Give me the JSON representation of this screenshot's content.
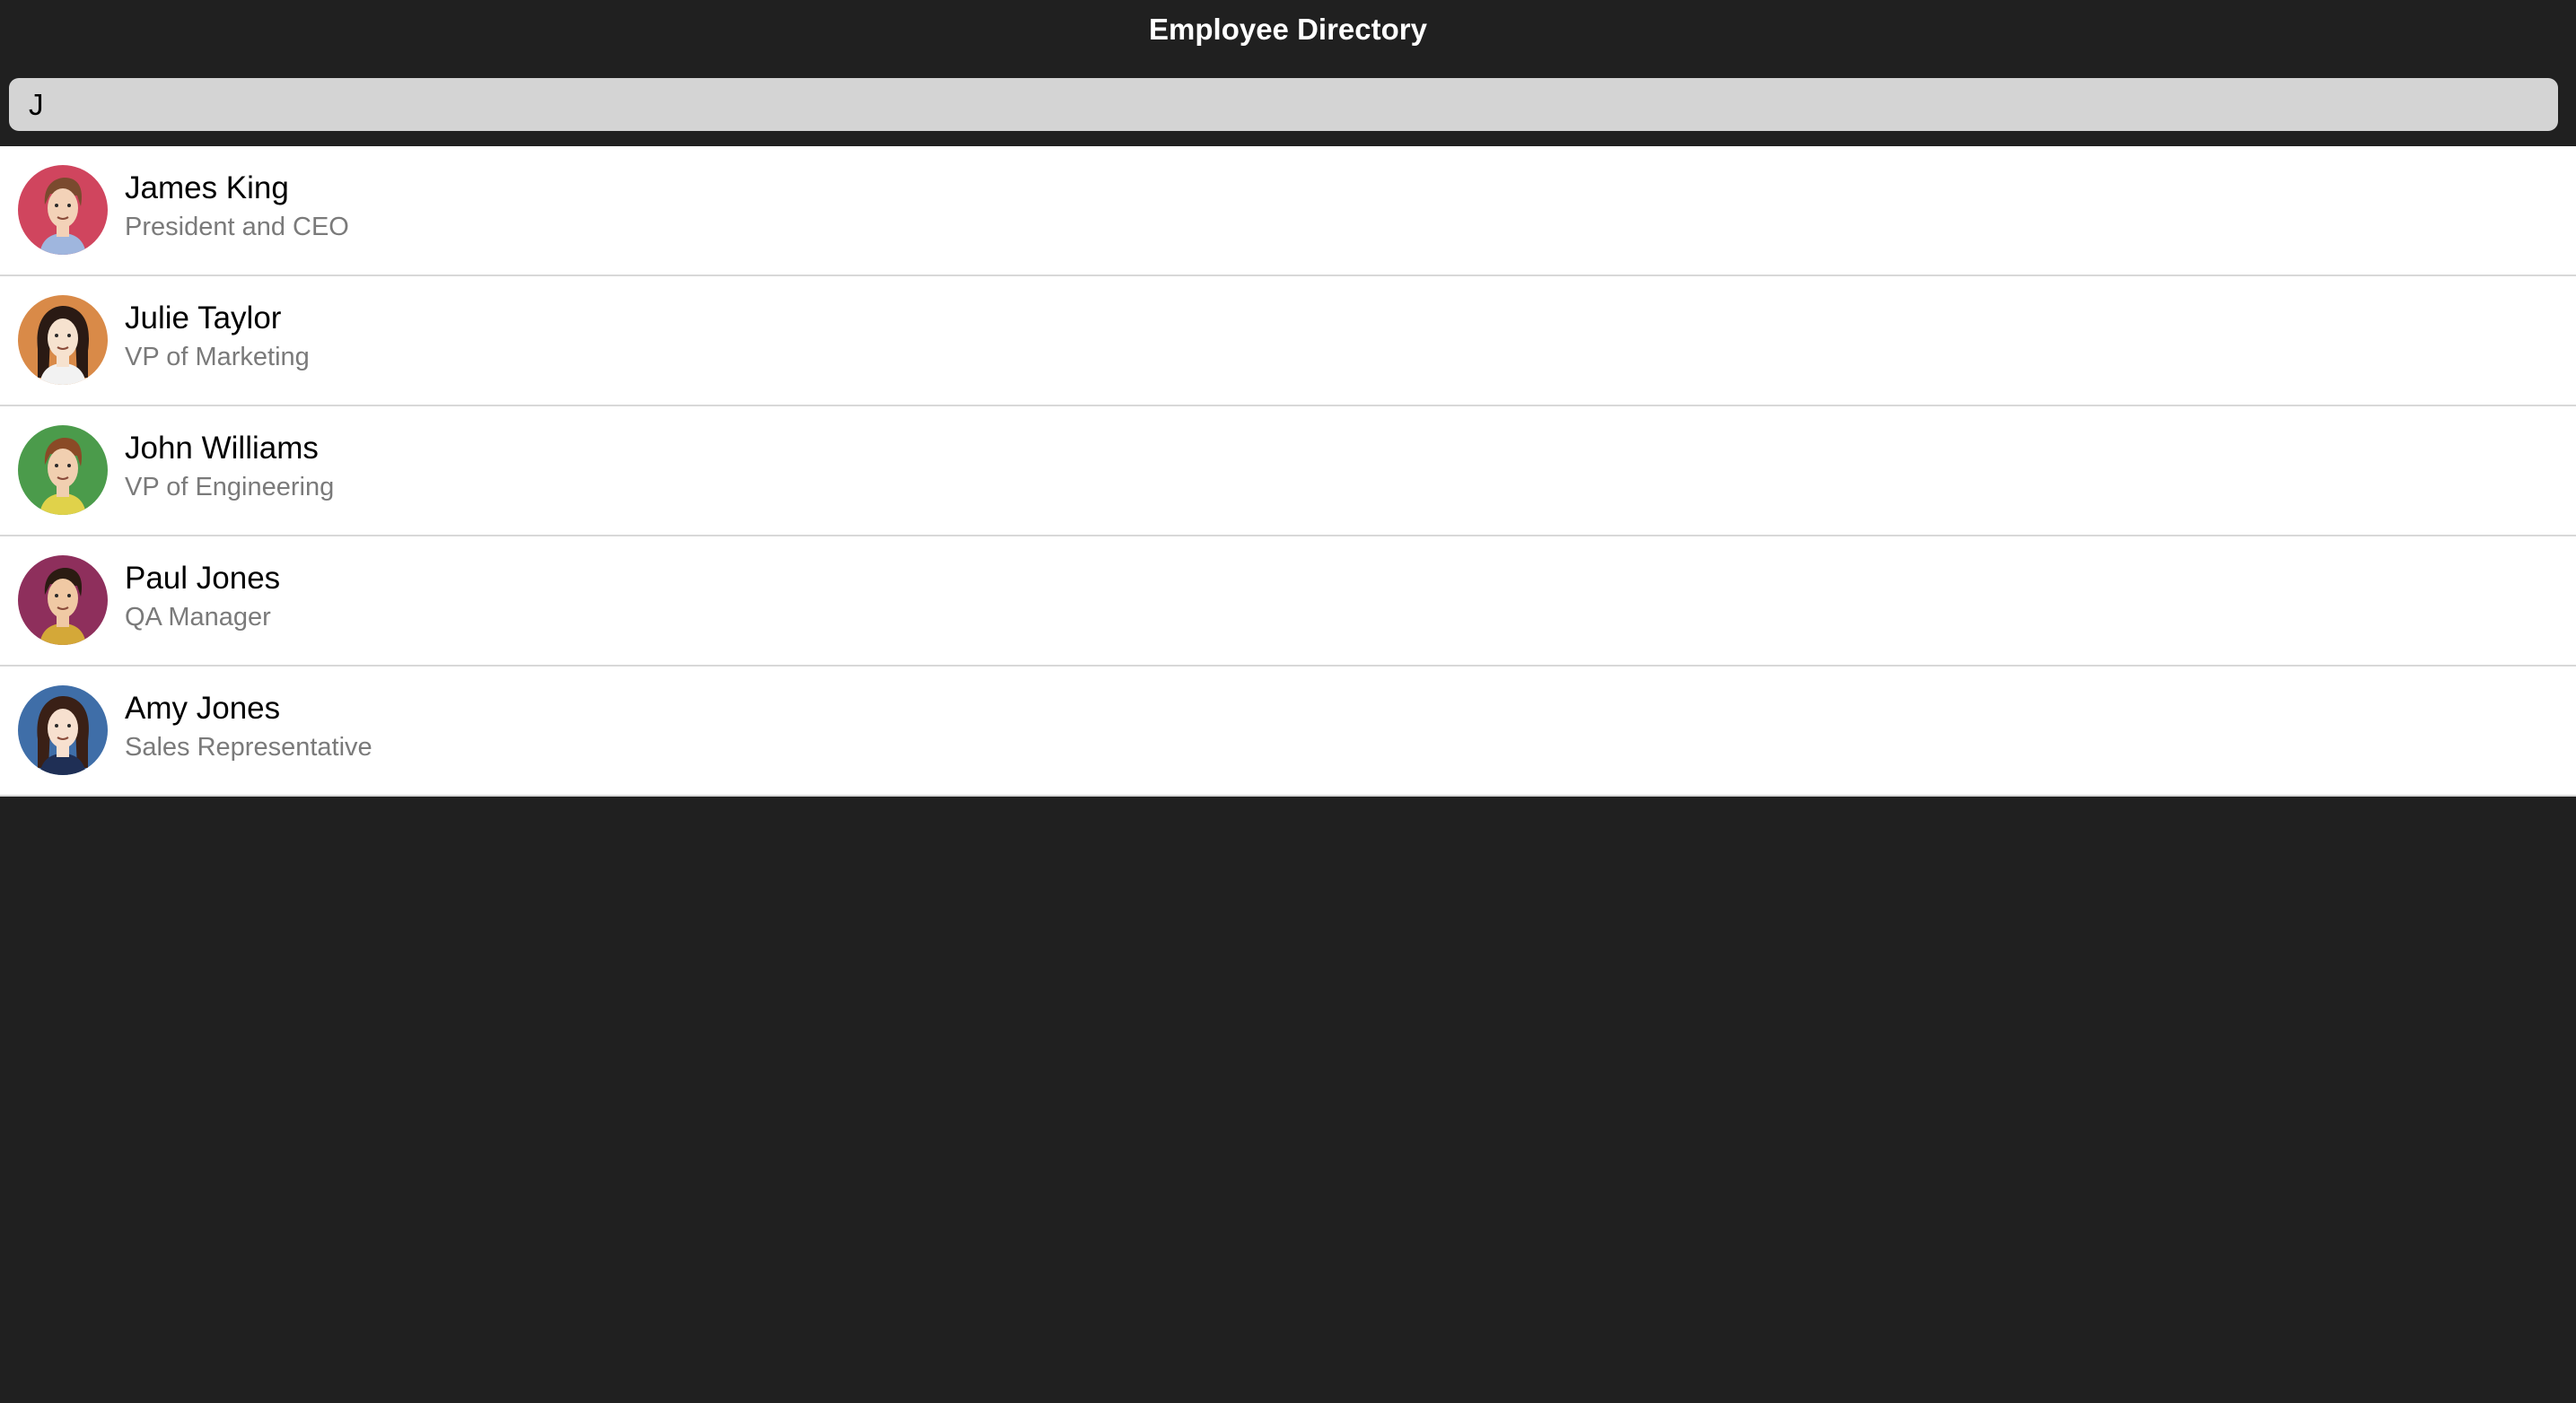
{
  "app": {
    "title": "Employee Directory"
  },
  "search": {
    "value": "J",
    "placeholder": ""
  },
  "employees": [
    {
      "name": "James King",
      "title": "President and CEO",
      "avatar": {
        "bg": "#d0455e",
        "hair": "#7a4a2e",
        "skin": "#f3d2b8",
        "shirt": "#9fb6de",
        "icon": "avatar-man-icon"
      }
    },
    {
      "name": "Julie Taylor",
      "title": "VP of Marketing",
      "avatar": {
        "bg": "#d98a48",
        "hair": "#2a1a14",
        "skin": "#f6e2cf",
        "shirt": "#f2f2f2",
        "icon": "avatar-woman-icon"
      }
    },
    {
      "name": "John Williams",
      "title": "VP of Engineering",
      "avatar": {
        "bg": "#4b9b4b",
        "hair": "#8a4a26",
        "skin": "#f1cfb0",
        "shirt": "#e0d24a",
        "icon": "avatar-man-icon"
      }
    },
    {
      "name": "Paul Jones",
      "title": "QA Manager",
      "avatar": {
        "bg": "#8e2f5c",
        "hair": "#2b1b12",
        "skin": "#f0c9a4",
        "shirt": "#d4a838",
        "icon": "avatar-man-icon"
      }
    },
    {
      "name": "Amy Jones",
      "title": "Sales Representative",
      "avatar": {
        "bg": "#3f6ea8",
        "hair": "#3a2016",
        "skin": "#f7e0cf",
        "shirt": "#1f2f55",
        "icon": "avatar-woman-icon"
      }
    }
  ]
}
